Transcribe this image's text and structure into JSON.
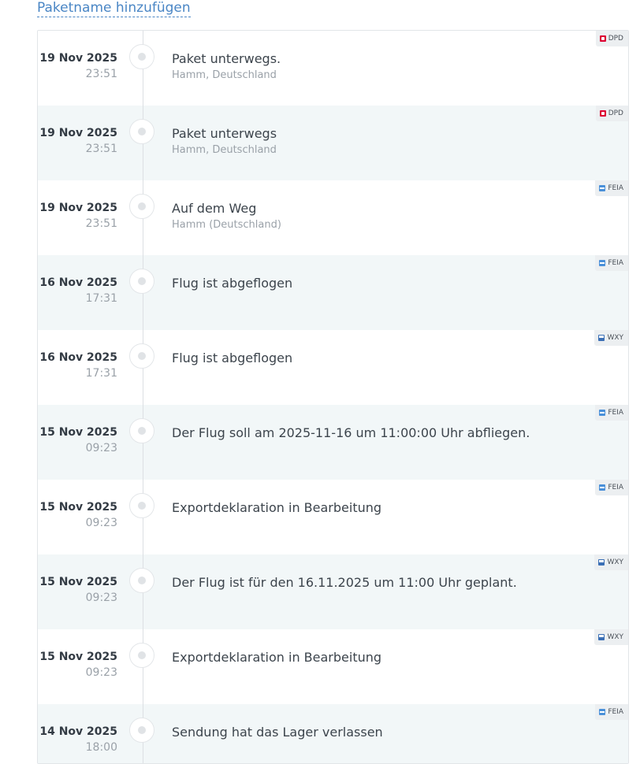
{
  "header": {
    "add_name_link": "Paketname hinzufügen"
  },
  "events": [
    {
      "date": "19 Nov 2025",
      "time": "23:51",
      "status": "Paket unterwegs.",
      "location": "Hamm, Deutschland",
      "carrier": "DPD",
      "carrier_icon": "dpd-logo-icon",
      "shaded": false
    },
    {
      "date": "19 Nov 2025",
      "time": "23:51",
      "status": "Paket unterwegs",
      "location": "Hamm, Deutschland",
      "carrier": "DPD",
      "carrier_icon": "dpd-logo-icon",
      "shaded": true
    },
    {
      "date": "19 Nov 2025",
      "time": "23:51",
      "status": "Auf dem Weg",
      "location": "Hamm (Deutschland)",
      "carrier": "FEIA",
      "carrier_icon": "feia-logo-icon",
      "shaded": false
    },
    {
      "date": "16 Nov 2025",
      "time": "17:31",
      "status": "Flug ist abgeflogen",
      "location": "",
      "carrier": "FEIA",
      "carrier_icon": "feia-logo-icon",
      "shaded": true
    },
    {
      "date": "16 Nov 2025",
      "time": "17:31",
      "status": "Flug ist abgeflogen",
      "location": "",
      "carrier": "WXY",
      "carrier_icon": "wxy-logo-icon",
      "shaded": false
    },
    {
      "date": "15 Nov 2025",
      "time": "09:23",
      "status": "Der Flug soll am 2025-11-16 um 11:00:00 Uhr abfliegen.",
      "location": "",
      "carrier": "FEIA",
      "carrier_icon": "feia-logo-icon",
      "shaded": true
    },
    {
      "date": "15 Nov 2025",
      "time": "09:23",
      "status": "Exportdeklaration in Bearbeitung",
      "location": "",
      "carrier": "FEIA",
      "carrier_icon": "feia-logo-icon",
      "shaded": false
    },
    {
      "date": "15 Nov 2025",
      "time": "09:23",
      "status": "Der Flug ist für den 16.11.2025 um 11:00 Uhr geplant.",
      "location": "",
      "carrier": "WXY",
      "carrier_icon": "wxy-logo-icon",
      "shaded": true
    },
    {
      "date": "15 Nov 2025",
      "time": "09:23",
      "status": "Exportdeklaration in Bearbeitung",
      "location": "",
      "carrier": "WXY",
      "carrier_icon": "wxy-logo-icon",
      "shaded": false
    },
    {
      "date": "14 Nov 2025",
      "time": "18:00",
      "status": "Sendung hat das Lager verlassen",
      "location": "",
      "carrier": "FEIA",
      "carrier_icon": "feia-logo-icon",
      "shaded": true
    }
  ],
  "colors": {
    "link": "#4a86c5",
    "row_shade": "#f2f7f8",
    "text": "#3c444c",
    "muted": "#9aa1a8",
    "dpd": "#dc0032",
    "feia": "#4a90d9",
    "wxy": "#3b6fb5"
  }
}
